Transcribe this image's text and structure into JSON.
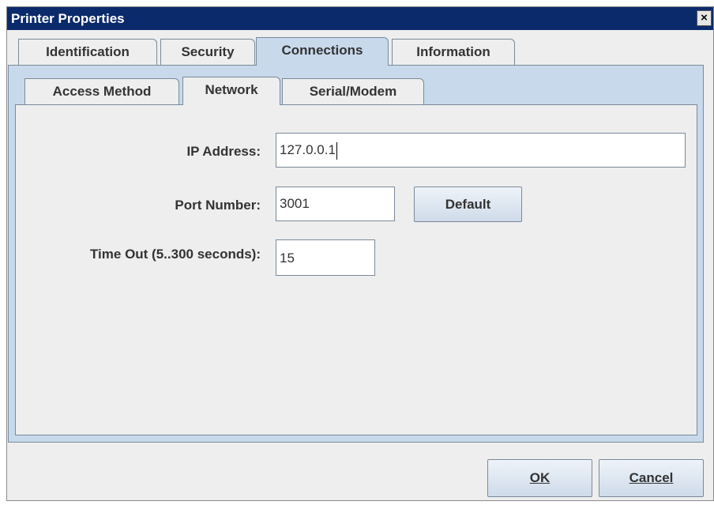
{
  "window": {
    "title": "Printer Properties",
    "close_glyph": "×"
  },
  "outer_tabs": [
    {
      "label": "Identification"
    },
    {
      "label": "Security"
    },
    {
      "label": "Connections",
      "selected": true
    },
    {
      "label": "Information"
    }
  ],
  "inner_tabs": [
    {
      "label": "Access Method"
    },
    {
      "label": "Network",
      "selected": true
    },
    {
      "label": "Serial/Modem"
    }
  ],
  "form": {
    "ip_label": "IP Address:",
    "ip_value": "127.0.0.1",
    "port_label": "Port Number:",
    "port_value": "3001",
    "default_button": "Default",
    "timeout_label": "Time Out (5..300 seconds):",
    "timeout_value": "15"
  },
  "buttons": {
    "ok": "OK",
    "cancel": "Cancel"
  },
  "colors": {
    "title_bar": "#0b2a6b",
    "selected_tab": "#c9d9ec",
    "window_bg": "#eeeeee"
  }
}
